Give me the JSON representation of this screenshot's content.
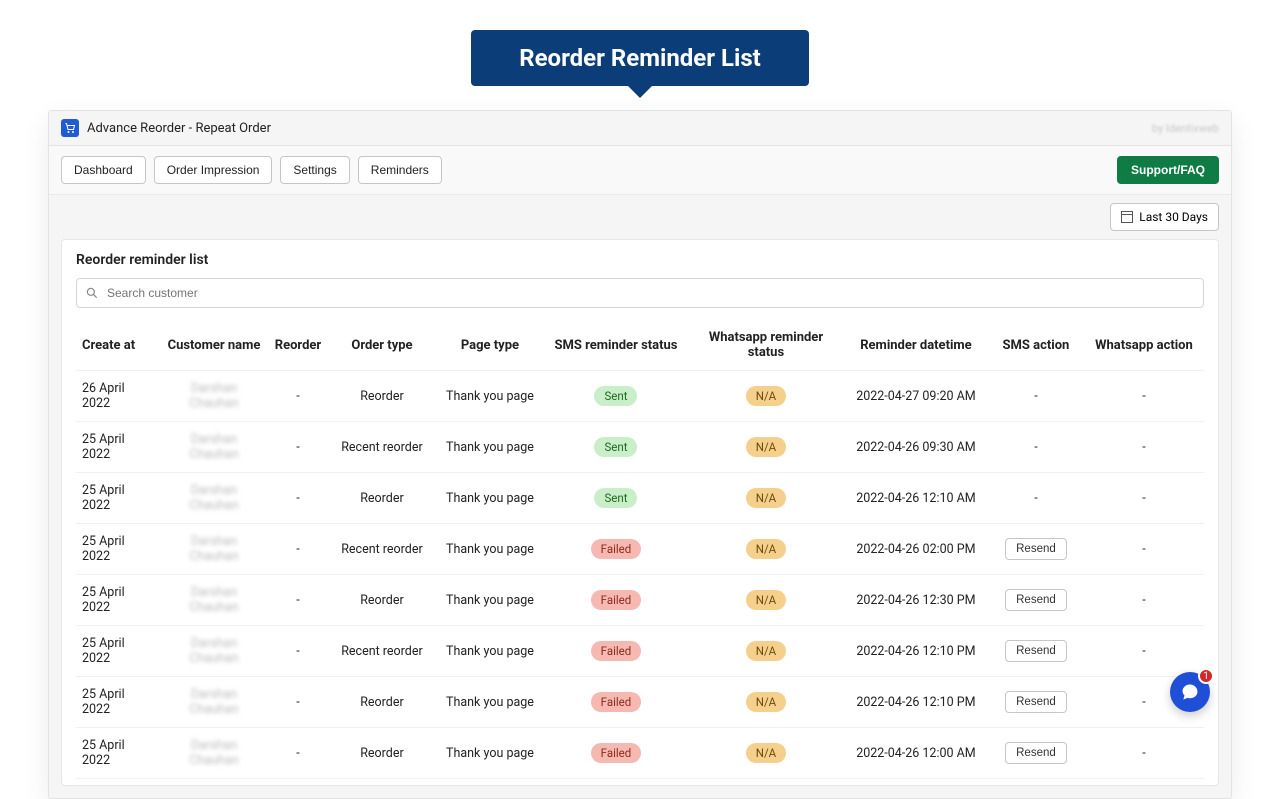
{
  "callout": "Reorder Reminder List",
  "app": {
    "title": "Advance Reorder - Repeat Order",
    "credit": "by Identixweb"
  },
  "nav": {
    "dashboard": "Dashboard",
    "order_impression": "Order Impression",
    "settings": "Settings",
    "reminders": "Reminders",
    "support": "Support/FAQ"
  },
  "filter": {
    "last30": "Last 30 Days"
  },
  "panel": {
    "title": "Reorder reminder list",
    "search_placeholder": "Search customer"
  },
  "columns": {
    "create_at": "Create at",
    "customer_name": "Customer name",
    "reorder": "Reorder",
    "order_type": "Order type",
    "page_type": "Page type",
    "sms_status": "SMS reminder status",
    "wa_status": "Whatsapp reminder status",
    "reminder_dt": "Reminder datetime",
    "sms_action": "SMS action",
    "wa_action": "Whatsapp action"
  },
  "badges": {
    "sent": "Sent",
    "failed": "Failed",
    "na": "N/A"
  },
  "buttons": {
    "resend": "Resend",
    "dash": "-"
  },
  "chat": {
    "badge": "1"
  },
  "blurred_name": "Darshan Chauhan",
  "rows": [
    {
      "date": "26 April 2022",
      "reorder": "-",
      "order_type": "Reorder",
      "page_type": "Thank you page",
      "sms": "sent",
      "wa": "na",
      "dt": "2022-04-27 09:20 AM",
      "sms_action": "-",
      "wa_action": "-"
    },
    {
      "date": "25 April 2022",
      "reorder": "-",
      "order_type": "Recent reorder",
      "page_type": "Thank you page",
      "sms": "sent",
      "wa": "na",
      "dt": "2022-04-26 09:30 AM",
      "sms_action": "-",
      "wa_action": "-"
    },
    {
      "date": "25 April 2022",
      "reorder": "-",
      "order_type": "Reorder",
      "page_type": "Thank you page",
      "sms": "sent",
      "wa": "na",
      "dt": "2022-04-26 12:10 AM",
      "sms_action": "-",
      "wa_action": "-"
    },
    {
      "date": "25 April 2022",
      "reorder": "-",
      "order_type": "Recent reorder",
      "page_type": "Thank you page",
      "sms": "failed",
      "wa": "na",
      "dt": "2022-04-26 02:00 PM",
      "sms_action": "resend",
      "wa_action": "-"
    },
    {
      "date": "25 April 2022",
      "reorder": "-",
      "order_type": "Reorder",
      "page_type": "Thank you page",
      "sms": "failed",
      "wa": "na",
      "dt": "2022-04-26 12:30 PM",
      "sms_action": "resend",
      "wa_action": "-"
    },
    {
      "date": "25 April 2022",
      "reorder": "-",
      "order_type": "Recent reorder",
      "page_type": "Thank you page",
      "sms": "failed",
      "wa": "na",
      "dt": "2022-04-26 12:10 PM",
      "sms_action": "resend",
      "wa_action": "-"
    },
    {
      "date": "25 April 2022",
      "reorder": "-",
      "order_type": "Reorder",
      "page_type": "Thank you page",
      "sms": "failed",
      "wa": "na",
      "dt": "2022-04-26 12:10 PM",
      "sms_action": "resend",
      "wa_action": "-"
    },
    {
      "date": "25 April 2022",
      "reorder": "-",
      "order_type": "Reorder",
      "page_type": "Thank you page",
      "sms": "failed",
      "wa": "na",
      "dt": "2022-04-26 12:00 AM",
      "sms_action": "resend",
      "wa_action": "-"
    }
  ]
}
